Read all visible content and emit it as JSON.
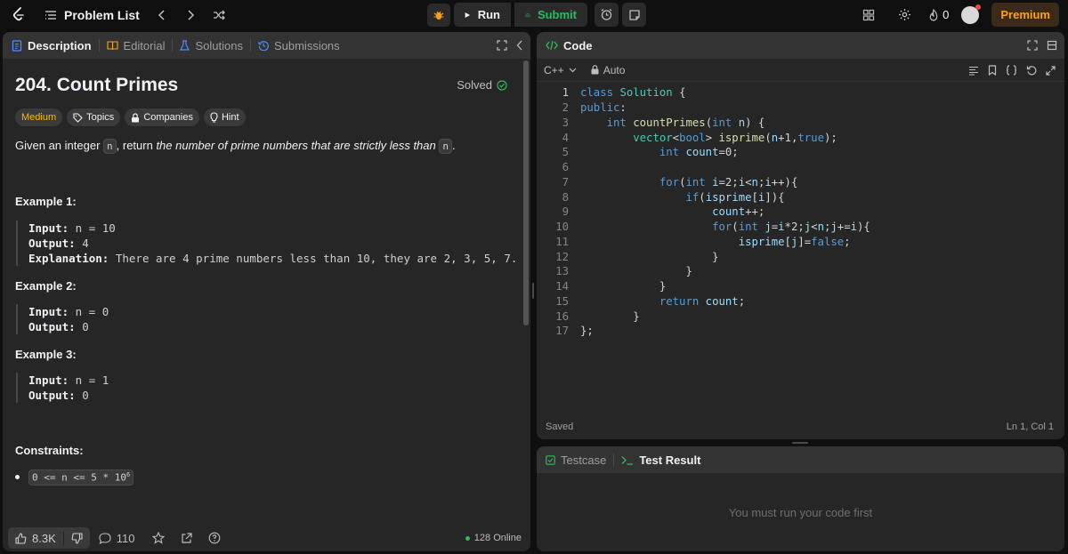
{
  "topbar": {
    "problem_list": "Problem List",
    "run": "Run",
    "submit": "Submit",
    "streak": "0",
    "premium": "Premium"
  },
  "left_tabs": [
    {
      "label": "Description"
    },
    {
      "label": "Editorial"
    },
    {
      "label": "Solutions"
    },
    {
      "label": "Submissions"
    }
  ],
  "problem": {
    "title": "204. Count Primes",
    "status": "Solved",
    "difficulty": "Medium",
    "tags": [
      "Topics",
      "Companies",
      "Hint"
    ],
    "statement_pre": "Given an integer ",
    "var_n": "n",
    "statement_mid": ", return ",
    "statement_italic": "the number of prime numbers that are strictly less than ",
    "statement_end": "."
  },
  "examples": [
    {
      "title": "Example 1:",
      "input_label": "Input:",
      "input": " n = 10",
      "output_label": "Output:",
      "output": " 4",
      "explanation_label": "Explanation:",
      "explanation": " There are 4 prime numbers less than 10, they are 2, 3, 5, 7."
    },
    {
      "title": "Example 2:",
      "input_label": "Input:",
      "input": " n = 0",
      "output_label": "Output:",
      "output": " 0"
    },
    {
      "title": "Example 3:",
      "input_label": "Input:",
      "input": " n = 1",
      "output_label": "Output:",
      "output": " 0"
    }
  ],
  "constraints": {
    "title": "Constraints:",
    "item": "0 <= n <= 5 * 10",
    "exponent": "6"
  },
  "bottom": {
    "likes": "8.3K",
    "comments": "110",
    "online": "128 Online"
  },
  "code": {
    "tab": "Code",
    "language": "C++",
    "mode": "Auto",
    "status_left": "Saved",
    "status_right": "Ln 1, Col 1",
    "lines": [
      "class Solution {",
      "public:",
      "    int countPrimes(int n) {",
      "        vector<bool> isprime(n+1,true);",
      "            int count=0;",
      "",
      "            for(int i=2;i<n;i++){",
      "                if(isprime[i]){",
      "                    count++;",
      "                    for(int j=i*2;j<n;j+=i){",
      "                        isprime[j]=false;",
      "                    }",
      "                }",
      "            }",
      "            return count;",
      "        }",
      "};"
    ]
  },
  "test": {
    "tab_testcase": "Testcase",
    "tab_result": "Test Result",
    "message": "You must run your code first"
  },
  "colors": {
    "accent_orange": "#ffa116",
    "success_green": "#2cbb5d",
    "medium_yellow": "#ffb800"
  }
}
